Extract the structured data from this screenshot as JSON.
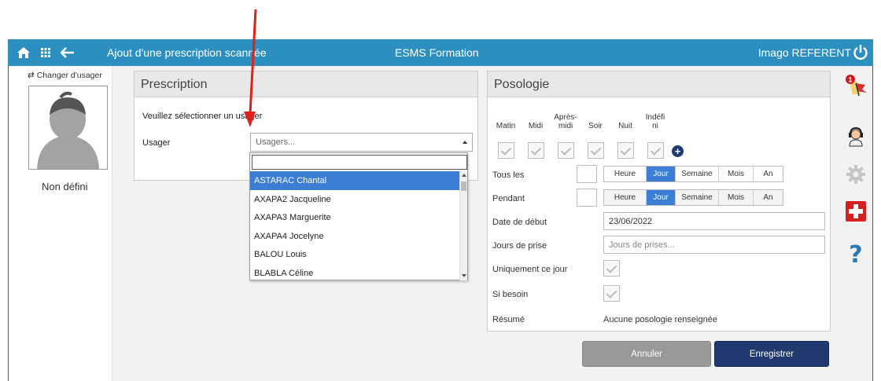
{
  "topbar": {
    "title": "Ajout d'une prescription scannée",
    "center": "ESMS Formation",
    "user": "Imago REFERENT",
    "icons": [
      "home-icon",
      "grid-icon",
      "back-arrow-icon",
      "power-icon"
    ]
  },
  "left": {
    "change_user": "⇄ Changer d'usager",
    "patient_name": "Non défini"
  },
  "prescription": {
    "title": "Prescription",
    "message": "Veuillez sélectionner un usager",
    "usager_label": "Usager",
    "select_placeholder": "Usagers...",
    "options": [
      "ASTARAC Chantal",
      "AXAPA2 Jacqueline",
      "AXAPA3 Marguerite",
      "AXAPA4 Jocelyne",
      "BALOU Louis",
      "BLABLA Céline"
    ],
    "selected_index": 0
  },
  "posologie": {
    "title": "Posologie",
    "moments": [
      {
        "line1": "",
        "line2": "Matin"
      },
      {
        "line1": "",
        "line2": "Midi"
      },
      {
        "line1": "Après-",
        "line2": "midi"
      },
      {
        "line1": "",
        "line2": "Soir"
      },
      {
        "line1": "",
        "line2": "Nuit"
      },
      {
        "line1": "Indéfi",
        "line2": "ni"
      }
    ],
    "tous_les_label": "Tous les",
    "pendant_label": "Pendant",
    "units": [
      "Heure",
      "Jour",
      "Semaine",
      "Mois",
      "An"
    ],
    "active_unit": "Jour",
    "date_label": "Date de début",
    "date_value": "23/06/2022",
    "jours_label": "Jours de prise",
    "jours_placeholder": "Jours de prises...",
    "unique_label": "Uniquement ce jour",
    "besoin_label": "Si besoin",
    "resume_label": "Résumé",
    "resume_value": "Aucune posologie renseignée"
  },
  "buttons": {
    "cancel": "Annuler",
    "save": "Enregistrer"
  },
  "colors": {
    "topbar": "#2c8fbf",
    "selection": "#3c7ed6",
    "save_button": "#1e3a6e",
    "cancel_button": "#999999",
    "annotation_arrow": "#e0201a"
  },
  "right_icons": [
    "alerts-flag-icon",
    "support-headset-icon",
    "settings-gear-icon",
    "medical-cross-icon",
    "help-icon"
  ],
  "notification_count": "1"
}
